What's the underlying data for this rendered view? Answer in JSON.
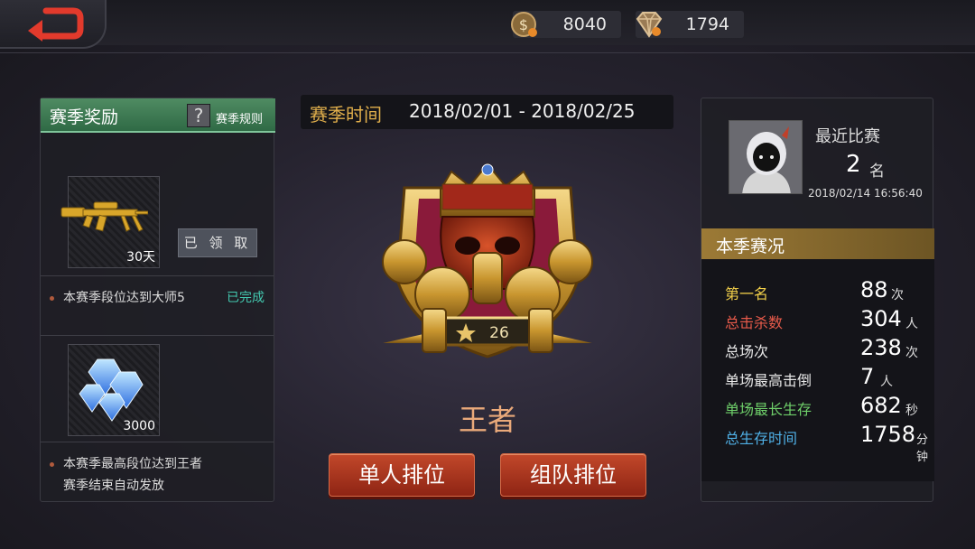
{
  "currency": {
    "gold": "8040",
    "diamond": "1794"
  },
  "season_rewards": {
    "title": "赛季奖励",
    "rule_icon": "?",
    "rule_label": "赛季规则",
    "rewards": [
      {
        "item_icon": "golden-rifle-icon",
        "amount": "30天",
        "button_label": "已 领 取",
        "task": "本赛季段位达到大师5",
        "status": "已完成"
      },
      {
        "item_icon": "diamond-pile-icon",
        "amount": "3000",
        "task_line1": "本赛季最高段位达到王者",
        "task_line2": "赛季结束自动发放"
      }
    ]
  },
  "season_time": {
    "label": "赛季时间",
    "value": "2018/02/01 - 2018/02/25"
  },
  "rank": {
    "stars": "26",
    "name": "王者",
    "emblem_icon": "king-crown-emblem-icon"
  },
  "buttons": {
    "solo": "单人排位",
    "team": "组队排位"
  },
  "recent_match": {
    "label": "最近比赛",
    "rank": "2",
    "rank_unit": "名",
    "time": "2018/02/14 16:56:40"
  },
  "season_stats": {
    "title": "本季赛况",
    "rows": [
      {
        "label": "第一名",
        "value": "88",
        "unit": "次",
        "color": "#f2d04a"
      },
      {
        "label": "总击杀数",
        "value": "304",
        "unit": "人",
        "color": "#e75a4a"
      },
      {
        "label": "总场次",
        "value": "238",
        "unit": "次",
        "color": "#e8e8e8"
      },
      {
        "label": "单场最高击倒",
        "value": "7",
        "unit": "人",
        "color": "#e8e8e8"
      },
      {
        "label": "单场最长生存",
        "value": "682",
        "unit": "秒",
        "color": "#6fd06a"
      },
      {
        "label": "总生存时间",
        "value": "1758",
        "unit": "分钟",
        "color": "#4fb0e6"
      }
    ]
  },
  "colors": {
    "gold_accent": "#e2b04c",
    "green_header": "#3f7a55",
    "red_button": "#b2391f",
    "complete_text": "#43c9b0"
  }
}
